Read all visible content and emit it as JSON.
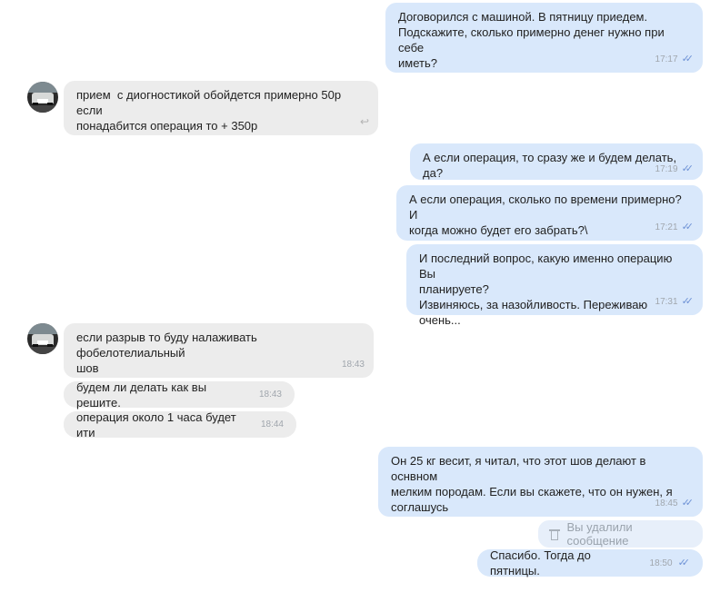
{
  "messages": [
    {
      "text": "Договорился с машиной. В пятницу приедем.\nПодскажите, сколько примерно денег нужно при себе\nиметь?",
      "time": "17:17",
      "direction": "out",
      "status": "read"
    },
    {
      "text": "прием  с диогностикой обойдется примерно 50р если\nпонадабится операция то + 350р",
      "time": "",
      "direction": "in",
      "icon": "reply-icon"
    },
    {
      "text": "А если операция, то сразу же и будем делать, да?",
      "time": "17:19",
      "direction": "out",
      "status": "read"
    },
    {
      "text": "А если операция, сколько по времени примерно? И\nкогда можно будет его забрать?\\",
      "time": "17:21",
      "direction": "out",
      "status": "read"
    },
    {
      "text": "И последний вопрос, какую именно операцию Вы\nпланируете?\nИзвиняюсь, за назойливость. Переживаю очень...",
      "time": "17:31",
      "direction": "out",
      "status": "read"
    },
    {
      "text": "если разрыв то буду налаживать фобелотелиальный\nшов",
      "time": "18:43",
      "direction": "in"
    },
    {
      "text": "будем ли делать как вы решите.",
      "time": "18:43",
      "direction": "in"
    },
    {
      "text": "операция около 1 часа будет ити",
      "time": "18:44",
      "direction": "in"
    },
    {
      "text": "Он 25 кг весит, я читал, что этот шов делают в оснвном\nмелким породам. Если вы скажете, что он нужен, я\nсоглашусь",
      "time": "18:45",
      "direction": "out",
      "status": "read"
    },
    {
      "text": "Вы удалили сообщение",
      "direction": "out",
      "deleted": true
    },
    {
      "text": "Спасибо. Тогда до пятницы.",
      "time": "18:50",
      "direction": "out",
      "status": "read"
    }
  ],
  "icons": {
    "read_check": "double-check-icon",
    "reply": "reply-icon",
    "trash": "trash-icon",
    "avatar": "contact-avatar"
  }
}
